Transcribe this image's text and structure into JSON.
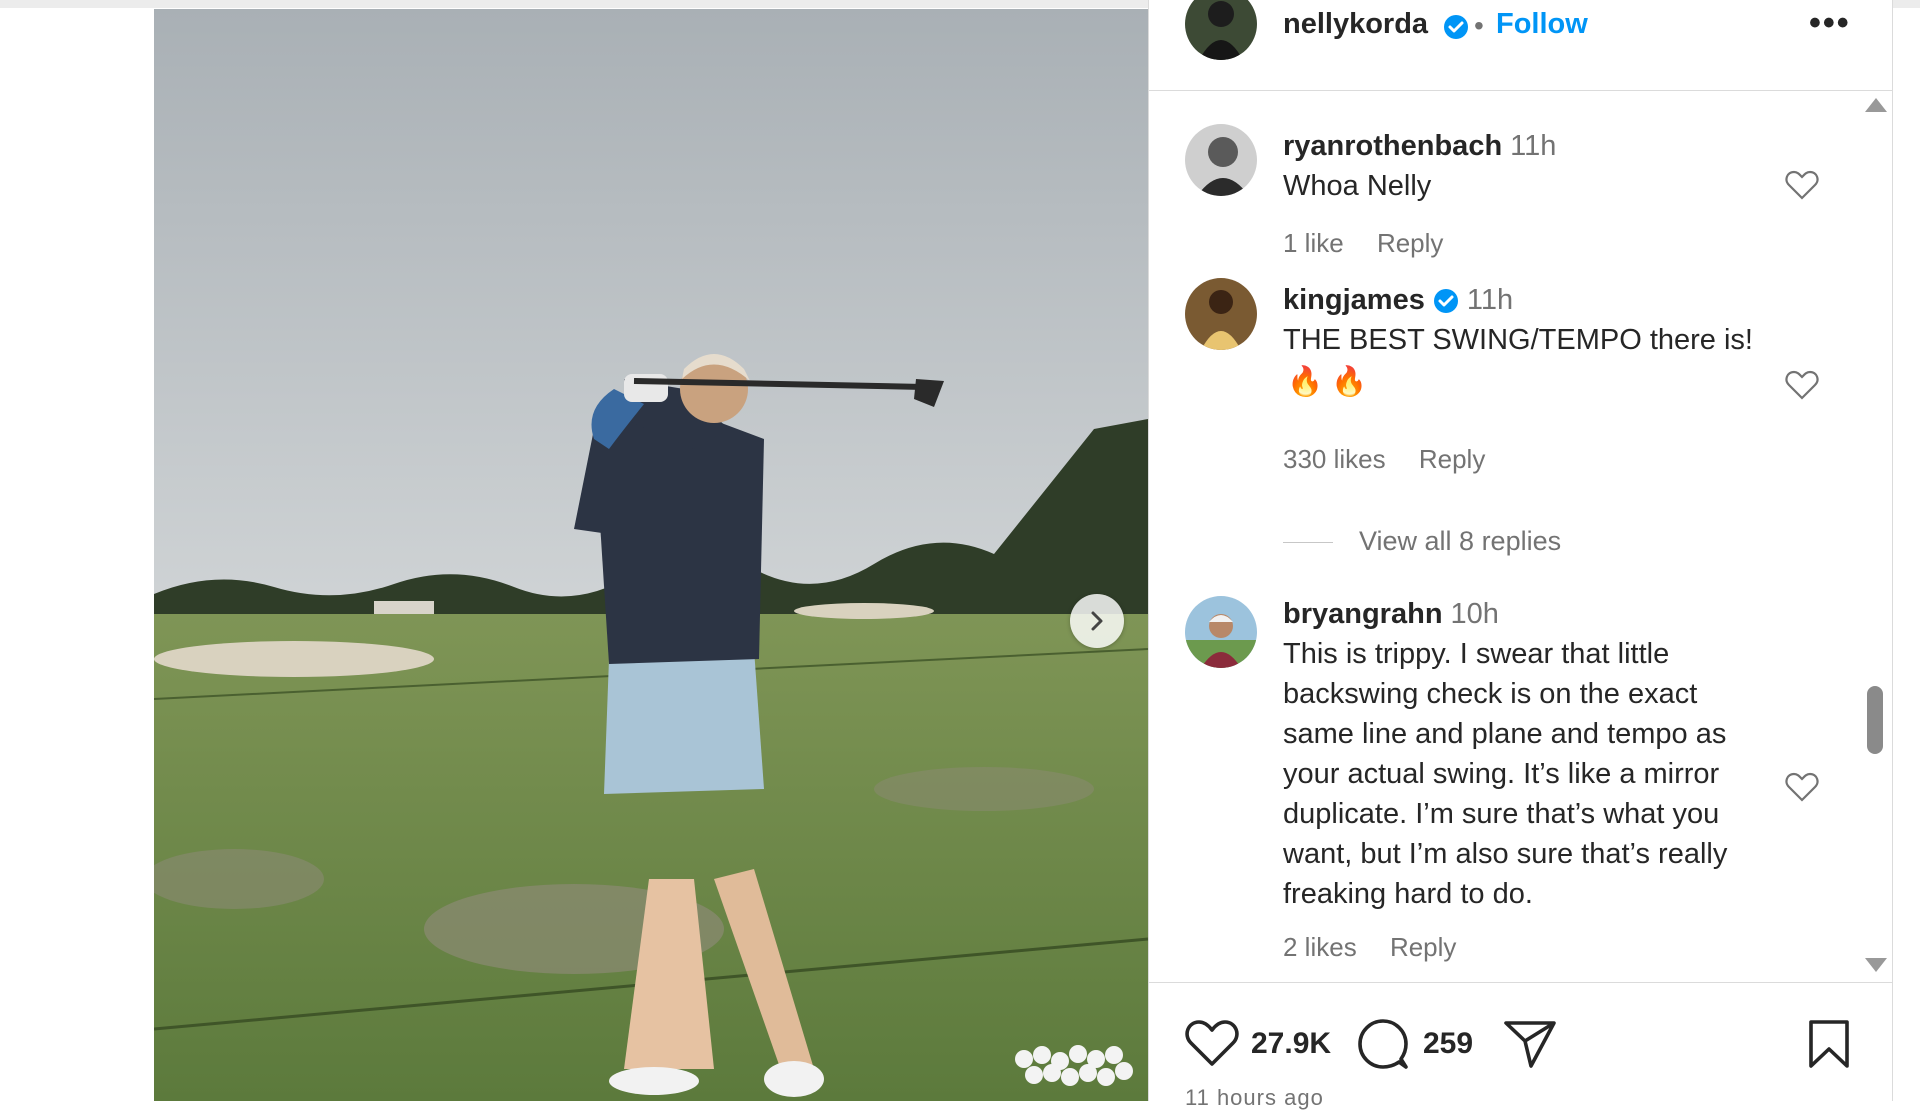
{
  "post": {
    "author": "nellykorda",
    "separator": "•",
    "follow_label": "Follow",
    "more_label": "•••",
    "time_ago": "11 hours ago"
  },
  "comments": [
    {
      "username": "ryanrothenbach",
      "time": "11h",
      "text": "Whoa Nelly",
      "likes": "1 like",
      "reply_label": "Reply"
    },
    {
      "username": "kingjames",
      "verified": true,
      "time": "11h",
      "text": "THE BEST SWING/TEMPO there is!",
      "emoji": "🔥 🔥",
      "likes": "330 likes",
      "reply_label": "Reply",
      "view_replies": "View all 8 replies"
    },
    {
      "username": "bryangrahn",
      "time": "10h",
      "text": "This is trippy. I swear that little backswing check is on the exact same line and plane and tempo as your actual swing. It’s like a mirror duplicate. I’m sure that’s what you want, but I’m also sure that’s really freaking hard to do.",
      "likes": "2 likes",
      "reply_label": "Reply"
    }
  ],
  "actions": {
    "like_count": "27.9K",
    "comment_count": "259"
  },
  "colors": {
    "follow": "#0095f6",
    "verified": "#0095f6",
    "muted": "#737373",
    "text": "#262626"
  },
  "icons": [
    "heart-icon",
    "comment-icon",
    "share-icon",
    "bookmark-icon",
    "verified-icon",
    "chevron-right-icon",
    "more-icon"
  ]
}
